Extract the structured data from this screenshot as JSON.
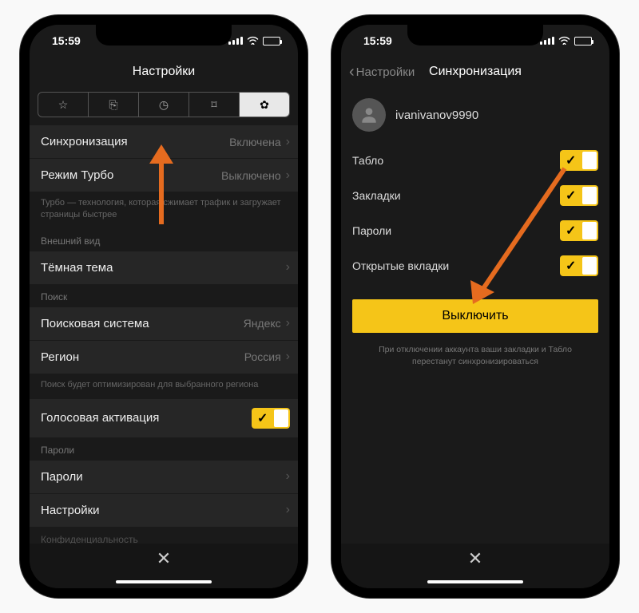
{
  "statusbar": {
    "time": "15:59"
  },
  "left": {
    "title": "Настройки",
    "rows": {
      "sync": {
        "label": "Синхронизация",
        "value": "Включена"
      },
      "turbo": {
        "label": "Режим Турбо",
        "value": "Выключено"
      },
      "turbo_desc": "Турбо — технология, которая сжимает трафик и загружает страницы быстрее",
      "appearance_header": "Внешний вид",
      "dark": {
        "label": "Тёмная тема"
      },
      "search_header": "Поиск",
      "engine": {
        "label": "Поисковая система",
        "value": "Яндекс"
      },
      "region": {
        "label": "Регион",
        "value": "Россия"
      },
      "region_desc": "Поиск будет оптимизирован для выбранного региона",
      "voice": {
        "label": "Голосовая активация"
      },
      "passwords_header": "Пароли",
      "passwords": {
        "label": "Пароли"
      },
      "settings": {
        "label": "Настройки"
      },
      "privacy_header": "Конфиденциальность"
    }
  },
  "right": {
    "back_label": "Настройки",
    "title": "Синхронизация",
    "username": "ivanivanov9990",
    "items": {
      "tablo": "Табло",
      "bookmarks": "Закладки",
      "passwords": "Пароли",
      "tabs": "Открытые вкладки"
    },
    "button": "Выключить",
    "warning": "При отключении аккаунта ваши закладки и Табло перестанут синхронизироваться"
  }
}
